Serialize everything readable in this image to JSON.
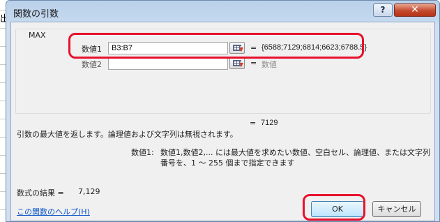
{
  "dialog": {
    "title": "関数の引数",
    "help_label": "?",
    "close_label": "✕"
  },
  "function": {
    "name": "MAX",
    "args": [
      {
        "label": "数値1",
        "value": "B3:B7",
        "result": "{6588;7129;6814;6623;6788.5}"
      },
      {
        "label": "数値2",
        "value": "",
        "result": "数値"
      }
    ],
    "equals": "=",
    "result": "7129"
  },
  "description": {
    "summary": "引数の最大値を返します。論理値および文字列は無視されます。",
    "arg_name": "数値1:",
    "arg_line1": "数値1,数値2,... には最大値を求めたい数値、空白セル、論理値、または文字列",
    "arg_line2": "番号を、1 ～ 255 個まで指定できます"
  },
  "formula_result": {
    "label": "数式の結果 =",
    "value": "7,129"
  },
  "help_link": "この関数のヘルプ(H)",
  "buttons": {
    "ok": "OK",
    "cancel": "キャンセル"
  },
  "background": {
    "partial_text": "出"
  },
  "colors": {
    "highlight": "#e8112d",
    "link": "#0e56c8",
    "title_gradient": "#b9d1ea",
    "close": "#c44a2e"
  }
}
